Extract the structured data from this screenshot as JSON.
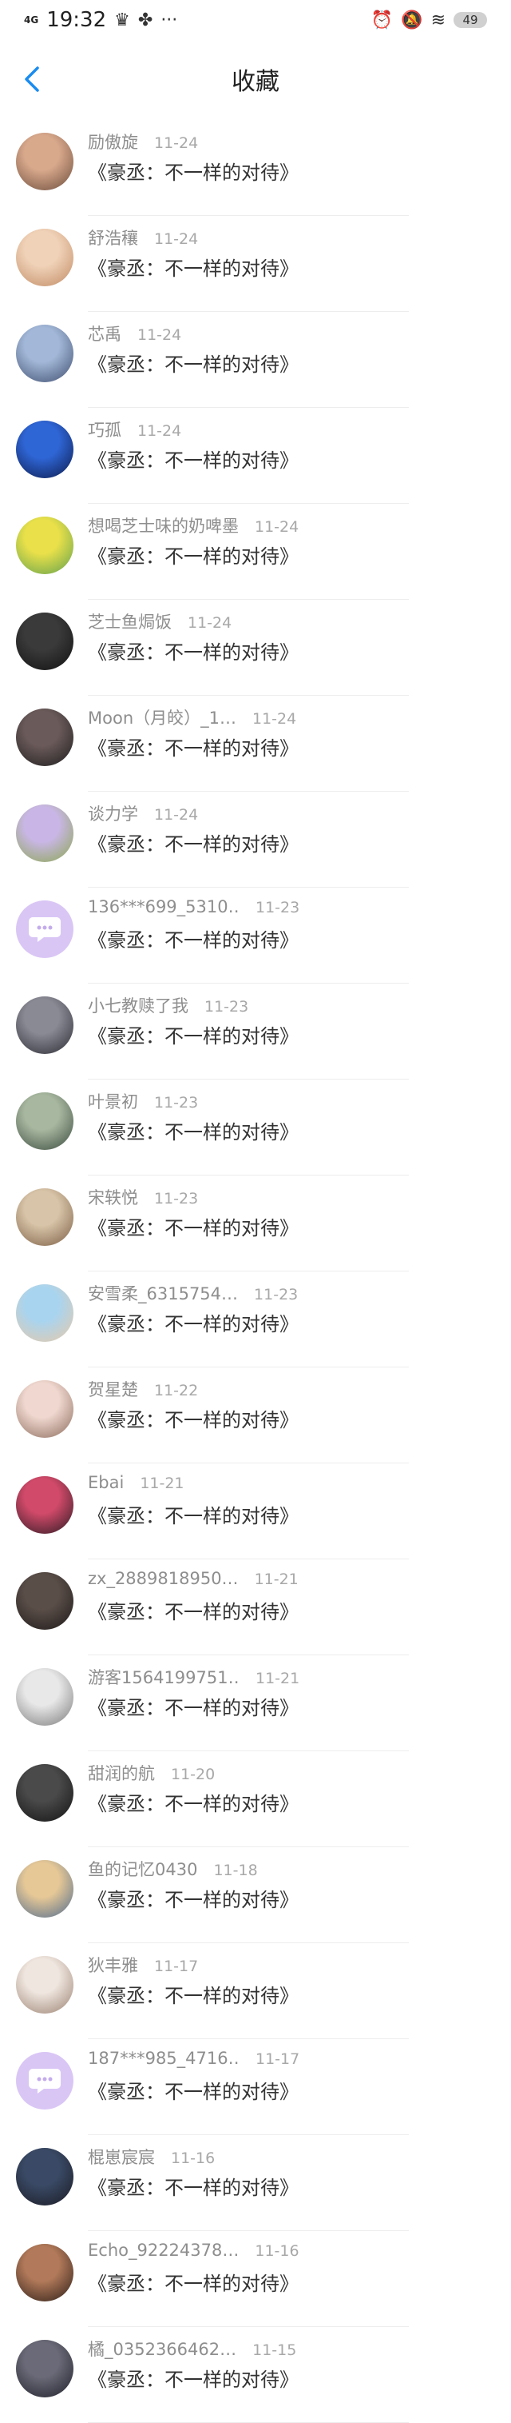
{
  "status": {
    "time": "19:32",
    "network": "4G",
    "battery": "49"
  },
  "header": {
    "title": "收藏"
  },
  "items": [
    {
      "name": "励傲旋",
      "date": "11-24",
      "title": "《豪丞：不一样的对待》",
      "avatar": "photo",
      "c1": "#d9a98c",
      "c2": "#6a4b3b"
    },
    {
      "name": "舒浩穰",
      "date": "11-24",
      "title": "《豪丞：不一样的对待》",
      "avatar": "photo",
      "c1": "#f0d2b8",
      "c2": "#c08a63"
    },
    {
      "name": "芯禹",
      "date": "11-24",
      "title": "《豪丞：不一样的对待》",
      "avatar": "photo",
      "c1": "#a3b8d8",
      "c2": "#3e4d6e"
    },
    {
      "name": "巧孤",
      "date": "11-24",
      "title": "《豪丞：不一样的对待》",
      "avatar": "photo",
      "c1": "#2f66d6",
      "c2": "#0c1a4a"
    },
    {
      "name": "想喝芝士味的奶啤墨",
      "date": "11-24",
      "title": "《豪丞：不一样的对待》",
      "avatar": "photo",
      "c1": "#e9e04a",
      "c2": "#5fa04d"
    },
    {
      "name": "芝士鱼焗饭",
      "date": "11-24",
      "title": "《豪丞：不一样的对待》",
      "avatar": "photo",
      "c1": "#3a3a3a",
      "c2": "#111111"
    },
    {
      "name": "Moon（月皎）_1…",
      "date": "11-24",
      "title": "《豪丞：不一样的对待》",
      "avatar": "photo",
      "c1": "#6b5a5a",
      "c2": "#1d1d1d"
    },
    {
      "name": "谈力学",
      "date": "11-24",
      "title": "《豪丞：不一样的对待》",
      "avatar": "photo",
      "c1": "#c9b6e6",
      "c2": "#8ba84f"
    },
    {
      "name": "136***699_5310…",
      "date": "11-23",
      "title": "《豪丞：不一样的对待》",
      "avatar": "bubble",
      "c1": "#d9c6f5",
      "c2": "#ffffff"
    },
    {
      "name": "小七教赎了我",
      "date": "11-23",
      "title": "《豪丞：不一样的对待》",
      "avatar": "photo",
      "c1": "#8a8a95",
      "c2": "#2b2b33"
    },
    {
      "name": "叶景初",
      "date": "11-23",
      "title": "《豪丞：不一样的对待》",
      "avatar": "photo",
      "c1": "#a8b8a0",
      "c2": "#3a4a3e"
    },
    {
      "name": "宋轶悦",
      "date": "11-23",
      "title": "《豪丞：不一样的对待》",
      "avatar": "photo",
      "c1": "#d8c4a8",
      "c2": "#7a5d44"
    },
    {
      "name": "安雪柔_6315754…",
      "date": "11-23",
      "title": "《豪丞：不一样的对待》",
      "avatar": "photo",
      "c1": "#a9d4ef",
      "c2": "#e8c9a8"
    },
    {
      "name": "贺星楚",
      "date": "11-22",
      "title": "《豪丞：不一样的对待》",
      "avatar": "photo",
      "c1": "#f0d8d0",
      "c2": "#8a6a5a"
    },
    {
      "name": "Ebai",
      "date": "11-21",
      "title": "《豪丞：不一样的对待》",
      "avatar": "photo",
      "c1": "#d24a6a",
      "c2": "#2a1a22"
    },
    {
      "name": "zx_2889818950…",
      "date": "11-21",
      "title": "《豪丞：不一样的对待》",
      "avatar": "photo",
      "c1": "#5a4e48",
      "c2": "#1c1818"
    },
    {
      "name": "游客1564199751…",
      "date": "11-21",
      "title": "《豪丞：不一样的对待》",
      "avatar": "photo",
      "c1": "#e8e8e8",
      "c2": "#7a7a7a"
    },
    {
      "name": "甜润的航",
      "date": "11-20",
      "title": "《豪丞：不一样的对待》",
      "avatar": "photo",
      "c1": "#4a4a4a",
      "c2": "#121212"
    },
    {
      "name": "鱼的记忆0430",
      "date": "11-18",
      "title": "《豪丞：不一样的对待》",
      "avatar": "photo",
      "c1": "#e6c896",
      "c2": "#4e6a8e"
    },
    {
      "name": "狄丰雅",
      "date": "11-17",
      "title": "《豪丞：不一样的对待》",
      "avatar": "photo",
      "c1": "#efe6df",
      "c2": "#9a8070"
    },
    {
      "name": "187***985_4716…",
      "date": "11-17",
      "title": "《豪丞：不一样的对待》",
      "avatar": "bubble",
      "c1": "#d9c6f5",
      "c2": "#ffffff"
    },
    {
      "name": "棍崽宸宸",
      "date": "11-16",
      "title": "《豪丞：不一样的对待》",
      "avatar": "photo",
      "c1": "#3a4a66",
      "c2": "#1a1a22"
    },
    {
      "name": "Echo_92224378…",
      "date": "11-16",
      "title": "《豪丞：不一样的对待》",
      "avatar": "photo",
      "c1": "#b27a5a",
      "c2": "#2a1c16"
    },
    {
      "name": "橘_0352366462…",
      "date": "11-15",
      "title": "《豪丞：不一样的对待》",
      "avatar": "photo",
      "c1": "#6a6a78",
      "c2": "#20202a"
    }
  ]
}
